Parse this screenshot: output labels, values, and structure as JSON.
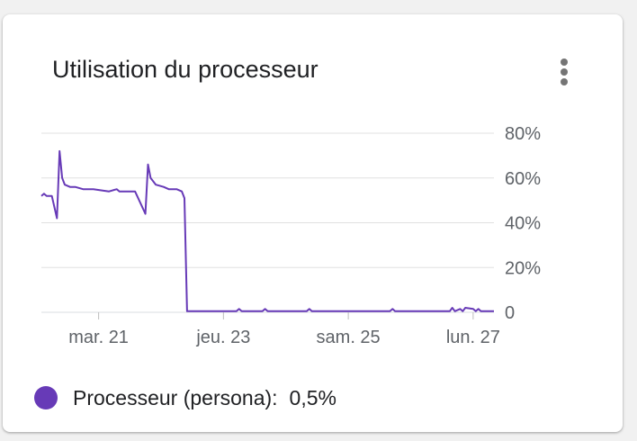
{
  "card": {
    "title": "Utilisation du processeur",
    "menu_icon": "more-vert-icon"
  },
  "colors": {
    "series": "#673ab7",
    "grid": "#e0e0e0",
    "axis_text": "#5f6368"
  },
  "chart_data": {
    "type": "line",
    "title": "Utilisation du processeur",
    "xlabel": "",
    "ylabel": "",
    "ylim": [
      0,
      80
    ],
    "y_ticks": [
      "80%",
      "60%",
      "40%",
      "20%",
      "0"
    ],
    "y_tick_values": [
      80,
      60,
      40,
      20,
      0
    ],
    "x_ticks": [
      "mar. 21",
      "jeu. 23",
      "sam. 25",
      "lun. 27"
    ],
    "x_tick_values": [
      "2021-09-21",
      "2021-09-23",
      "2021-09-25",
      "2021-09-27"
    ],
    "xlim": [
      "2021-09-20T02:00",
      "2021-09-27T08:00"
    ],
    "grid": true,
    "series": [
      {
        "name": "Processeur (persona)",
        "x": [
          "2021-09-20T02:00",
          "2021-09-20T03:00",
          "2021-09-20T04:00",
          "2021-09-20T05:00",
          "2021-09-20T06:00",
          "2021-09-20T08:00",
          "2021-09-20T09:00",
          "2021-09-20T10:00",
          "2021-09-20T11:00",
          "2021-09-20T13:00",
          "2021-09-20T15:00",
          "2021-09-20T18:00",
          "2021-09-20T22:00",
          "2021-09-21T04:00",
          "2021-09-21T07:00",
          "2021-09-21T08:00",
          "2021-09-21T09:00",
          "2021-09-21T14:00",
          "2021-09-21T18:00",
          "2021-09-21T19:00",
          "2021-09-21T20:00",
          "2021-09-21T22:00",
          "2021-09-22T01:00",
          "2021-09-22T03:00",
          "2021-09-22T06:00",
          "2021-09-22T08:00",
          "2021-09-22T09:00",
          "2021-09-22T10:00",
          "2021-09-22T11:00",
          "2021-09-23T00:00",
          "2021-09-23T05:00",
          "2021-09-23T06:00",
          "2021-09-23T07:00",
          "2021-09-23T15:00",
          "2021-09-23T16:00",
          "2021-09-23T17:00",
          "2021-09-24T08:00",
          "2021-09-24T09:00",
          "2021-09-24T10:00",
          "2021-09-25T16:00",
          "2021-09-25T17:00",
          "2021-09-25T18:00",
          "2021-09-26T15:00",
          "2021-09-26T16:00",
          "2021-09-26T17:00",
          "2021-09-26T19:00",
          "2021-09-26T20:00",
          "2021-09-26T21:00",
          "2021-09-27T00:00",
          "2021-09-27T01:00",
          "2021-09-27T02:00",
          "2021-09-27T03:00",
          "2021-09-27T04:00",
          "2021-09-27T08:00"
        ],
        "values": [
          52,
          53,
          52,
          52,
          52,
          42,
          72,
          60,
          57,
          56,
          56,
          55,
          55,
          54,
          55,
          54,
          54,
          54,
          44,
          66,
          60,
          57,
          56,
          55,
          55,
          54,
          51,
          0.5,
          0.5,
          0.5,
          0.5,
          1.5,
          0.5,
          0.5,
          1.5,
          0.5,
          0.5,
          1.5,
          0.5,
          0.5,
          1.5,
          0.5,
          0.5,
          2.0,
          0.5,
          1.5,
          0.5,
          2.0,
          1.5,
          0.5,
          1.5,
          0.5,
          0.5,
          0.5
        ]
      }
    ]
  },
  "legend": {
    "label": "Processeur (persona):",
    "value": "0,5%"
  }
}
